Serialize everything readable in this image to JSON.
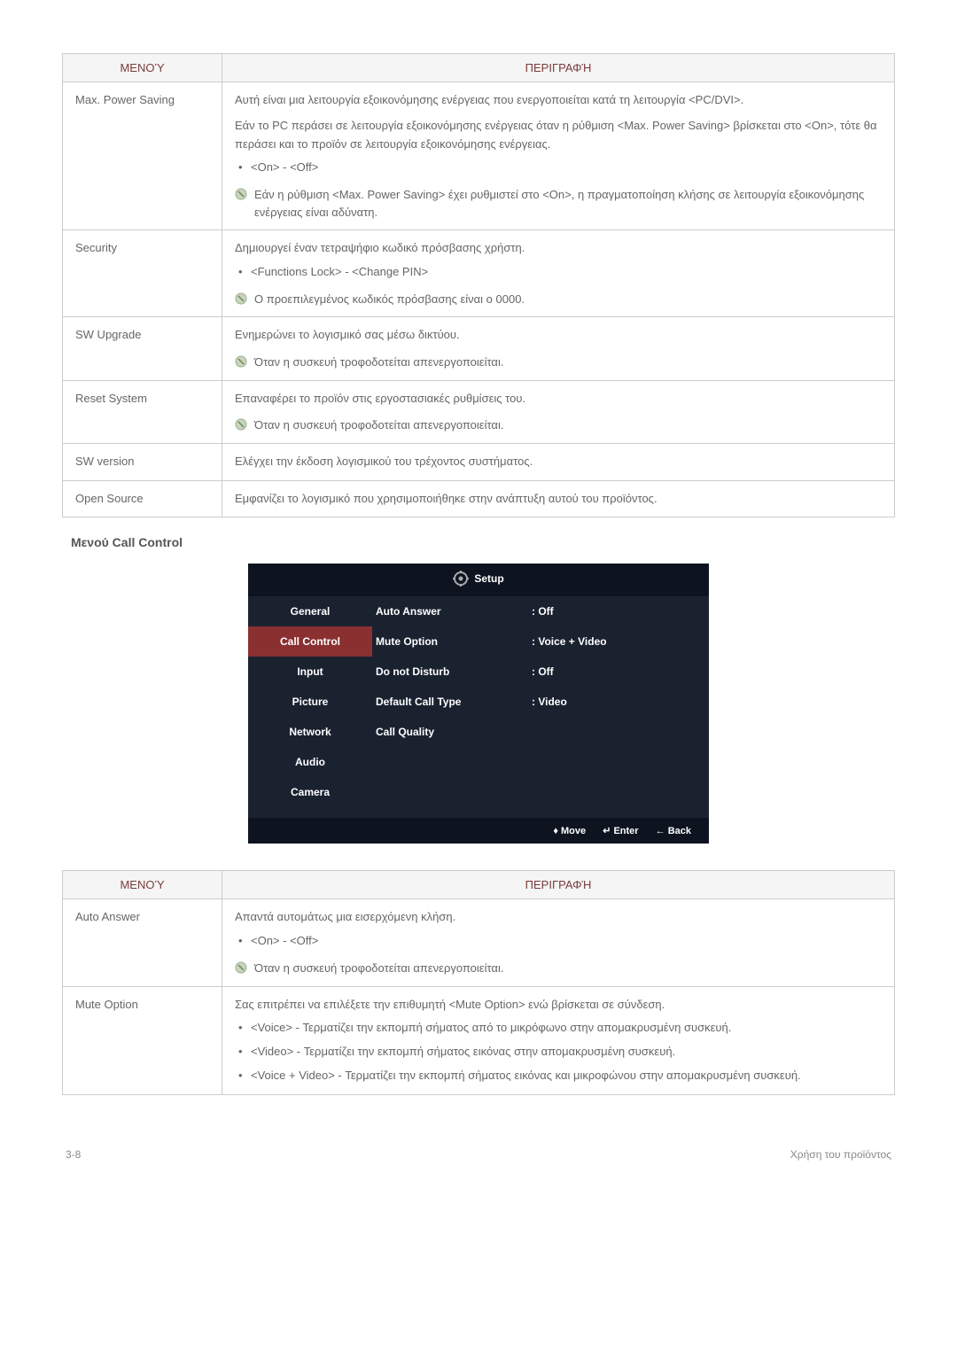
{
  "table1": {
    "headers": [
      "ΜΕΝΟΎ",
      "ΠΕΡΙΓΡΑΦΉ"
    ],
    "rows": [
      {
        "menu": "Max. Power Saving",
        "p1": "Αυτή είναι μια λειτουργία εξοικονόμησης ενέργειας που ενεργοποιείται κατά τη λειτουργία <PC/DVI>.",
        "p2": "Εάν το PC περάσει σε λειτουργία εξοικονόμησης ενέργειας όταν η ρύθμιση <Max. Power Saving> βρίσκεται στο <On>, τότε θα περάσει και το προϊόν σε λειτουργία εξοικονόμησης ενέργειας.",
        "bullet1": "<On> - <Off>",
        "note1": "Εάν η ρύθμιση <Max. Power Saving> έχει ρυθμιστεί στο <On>, η πραγματοποίηση κλήσης σε λειτουργία εξοικονόμησης ενέργειας είναι αδύνατη."
      },
      {
        "menu": "Security",
        "p1": "Δημιουργεί έναν τετραψήφιο κωδικό πρόσβασης χρήστη.",
        "bullet1": "<Functions Lock> - <Change PIN>",
        "note1": "Ο προεπιλεγμένος κωδικός πρόσβασης είναι ο 0000."
      },
      {
        "menu": "SW Upgrade",
        "p1": "Ενημερώνει το λογισμικό σας μέσω δικτύου.",
        "note1": "Όταν η συσκευή τροφοδοτείται απενεργοποιείται."
      },
      {
        "menu": "Reset System",
        "p1": "Επαναφέρει το προϊόν στις εργοστασιακές ρυθμίσεις του.",
        "note1": "Όταν η συσκευή τροφοδοτείται απενεργοποιείται."
      },
      {
        "menu": "SW version",
        "p1": "Ελέγχει την έκδοση λογισμικού του τρέχοντος συστήματος."
      },
      {
        "menu": "Open Source",
        "p1": "Εμφανίζει το λογισμικό που χρησιμοποιήθηκε στην ανάπτυξη αυτού του προϊόντος."
      }
    ]
  },
  "section_title": "Μενού Call Control",
  "setup": {
    "title": "Setup",
    "nav": [
      "General",
      "Call Control",
      "Input",
      "Picture",
      "Network",
      "Audio",
      "Camera"
    ],
    "active": "Call Control",
    "rows": [
      {
        "label": "Auto Answer",
        "value": ": Off"
      },
      {
        "label": "Mute Option",
        "value": ": Voice + Video"
      },
      {
        "label": "Do not Disturb",
        "value": ": Off"
      },
      {
        "label": "Default Call Type",
        "value": ": Video"
      },
      {
        "label": "Call Quality",
        "value": ""
      }
    ],
    "footer": {
      "move": "♦ Move",
      "enter": "↵ Enter",
      "back": "← Back"
    }
  },
  "table2": {
    "headers": [
      "ΜΕΝΟΎ",
      "ΠΕΡΙΓΡΑΦΉ"
    ],
    "rows": [
      {
        "menu": "Auto Answer",
        "p1": "Απαντά αυτομάτως μια εισερχόμενη κλήση.",
        "bullet1": "<On> - <Off>",
        "note1": "Όταν η συσκευή τροφοδοτείται απενεργοποιείται."
      },
      {
        "menu": "Mute Option",
        "p1": "Σας επιτρέπει να επιλέξετε την επιθυμητή <Mute Option> ενώ βρίσκεται σε σύνδεση.",
        "bullet1": "<Voice> - Τερματίζει την εκπομπή σήματος από το μικρόφωνο στην απομακρυσμένη συσκευή.",
        "bullet2": "<Video> - Τερματίζει την εκπομπή σήματος εικόνας στην απομακρυσμένη συσκευή.",
        "bullet3": "<Voice + Video> - Τερματίζει την εκπομπή σήματος εικόνας και μικροφώνου στην απομακρυσμένη συσκευή."
      }
    ]
  },
  "footer": {
    "left": "3-8",
    "right": "Χρήση του προϊόντος"
  }
}
